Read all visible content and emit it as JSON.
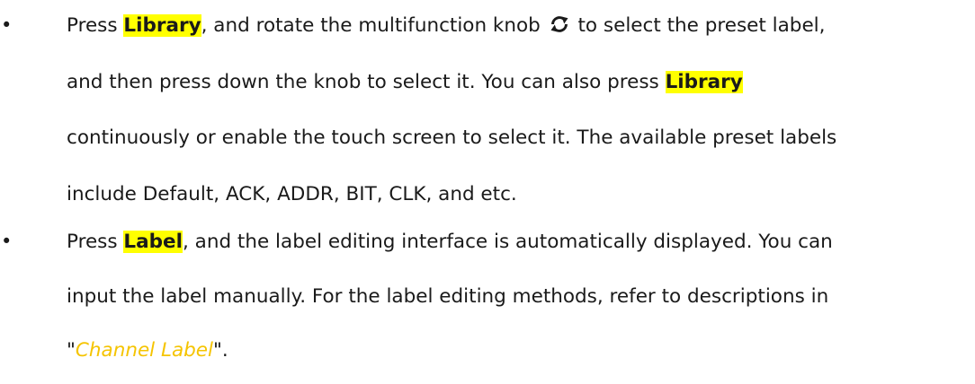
{
  "bullet_symbol": "•",
  "items": [
    {
      "lines": [
        {
          "pre": "Press ",
          "key": "Library",
          "post": ", and rotate the multifunction knob ",
          "icon": "rotate-knob-icon",
          "tail": " to select the preset label,"
        },
        {
          "pre": "and then press down the knob to select it. You can also press ",
          "key": "Library"
        },
        {
          "text": "continuously or enable the touch screen to select it. The available preset labels"
        },
        {
          "text": "include Default, ACK, ADDR, BIT, CLK, and etc."
        }
      ]
    },
    {
      "lines": [
        {
          "pre": "Press ",
          "key": "Label",
          "post": ", and the label editing interface is automatically displayed. You can"
        },
        {
          "text": "input the label manually. For the label editing methods, refer to descriptions in"
        },
        {
          "quote_open": "\"",
          "link": "Channel Label",
          "quote_close": "\"."
        }
      ]
    }
  ]
}
